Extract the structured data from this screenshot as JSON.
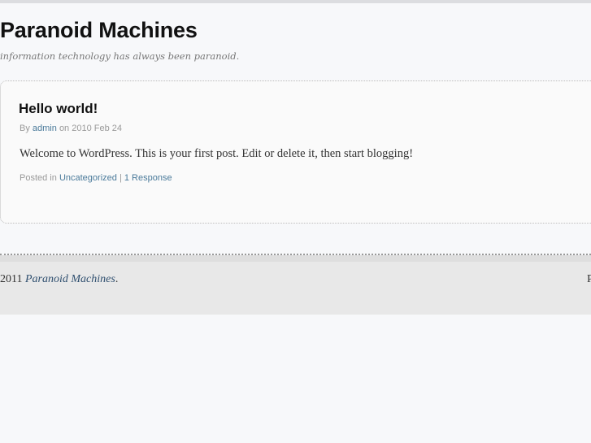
{
  "site": {
    "title": "Paranoid Machines",
    "tagline": "information technology has always been paranoid."
  },
  "post": {
    "title": "Hello world!",
    "meta": {
      "by": "By",
      "author": "admin",
      "on": "on 2010 Feb 24"
    },
    "content": "Welcome to WordPress. This is your first post. Edit or delete it, then start blogging!",
    "footer": {
      "posted_in": "Posted in",
      "category": "Uncategorized",
      "separator": "|",
      "responses": "1 Response"
    }
  },
  "footer": {
    "year": "2011",
    "site_link": "Paranoid Machines",
    "period": ".",
    "right_text": "P"
  }
}
